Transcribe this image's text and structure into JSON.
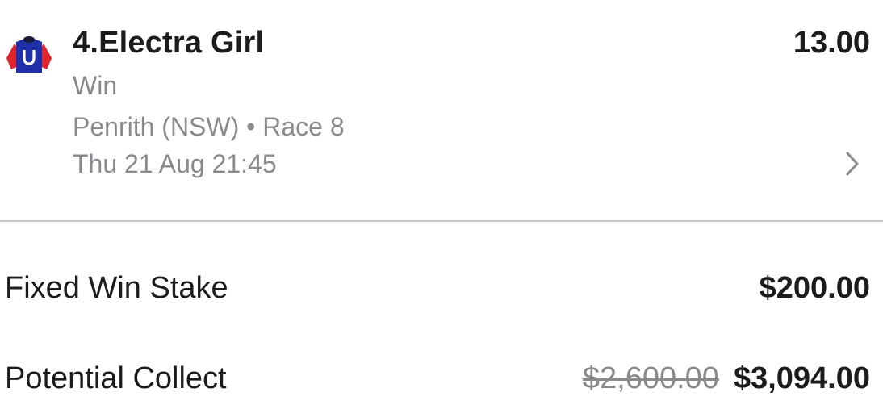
{
  "bet": {
    "runner": "4.Electra Girl",
    "odds": "13.00",
    "bet_type": "Win",
    "meeting": "Penrith (NSW) • Race 8",
    "start_time": "Thu 21 Aug 21:45",
    "silks_icon": "jockey-silks-icon",
    "silks_colors": {
      "body": "#1f2fa8",
      "sleeves": "#e0242d",
      "cap": "#1a1a3a",
      "emblem": "#ffffff"
    }
  },
  "summary": {
    "stake_label": "Fixed Win Stake",
    "stake_value": "$200.00",
    "collect_label": "Potential Collect",
    "collect_old": "$2,600.00",
    "collect_new": "$3,094.00"
  },
  "colors": {
    "primary_text": "#1c1c1e",
    "secondary_text": "#8a8a8e",
    "divider": "#c7c7cc"
  }
}
